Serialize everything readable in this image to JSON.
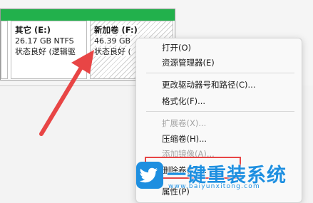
{
  "volumes": [
    {
      "name": "",
      "size": "",
      "status": ""
    },
    {
      "name": "其它 (E:)",
      "size": "26.17 GB NTFS",
      "status": "状态良好 (逻辑驱"
    },
    {
      "name": "新加卷 (F:)",
      "size": "46.39 GB",
      "status": "状态良好 ("
    }
  ],
  "context_menu": {
    "items": [
      {
        "label": "打开(O)",
        "disabled": false
      },
      {
        "label": "资源管理器(E)",
        "disabled": false
      },
      {
        "label": "更改驱动器号和路径(C)...",
        "disabled": false
      },
      {
        "label": "格式化(F)...",
        "disabled": false
      },
      {
        "label": "扩展卷(X)...",
        "disabled": true
      },
      {
        "label": "压缩卷(H)...",
        "disabled": false
      },
      {
        "label": "添加镜像(A)...",
        "disabled": true
      },
      {
        "label": "删除卷(D)...",
        "disabled": false
      },
      {
        "label": "属性(P)",
        "disabled": false
      }
    ]
  },
  "watermark": {
    "title": "一键重装系统",
    "url": "www.baiyunxitong.com"
  },
  "colors": {
    "volume_bar": "#22b14c",
    "arrow": "#e84545",
    "highlight": "#e84545",
    "watermark": "#1e8fe0"
  }
}
